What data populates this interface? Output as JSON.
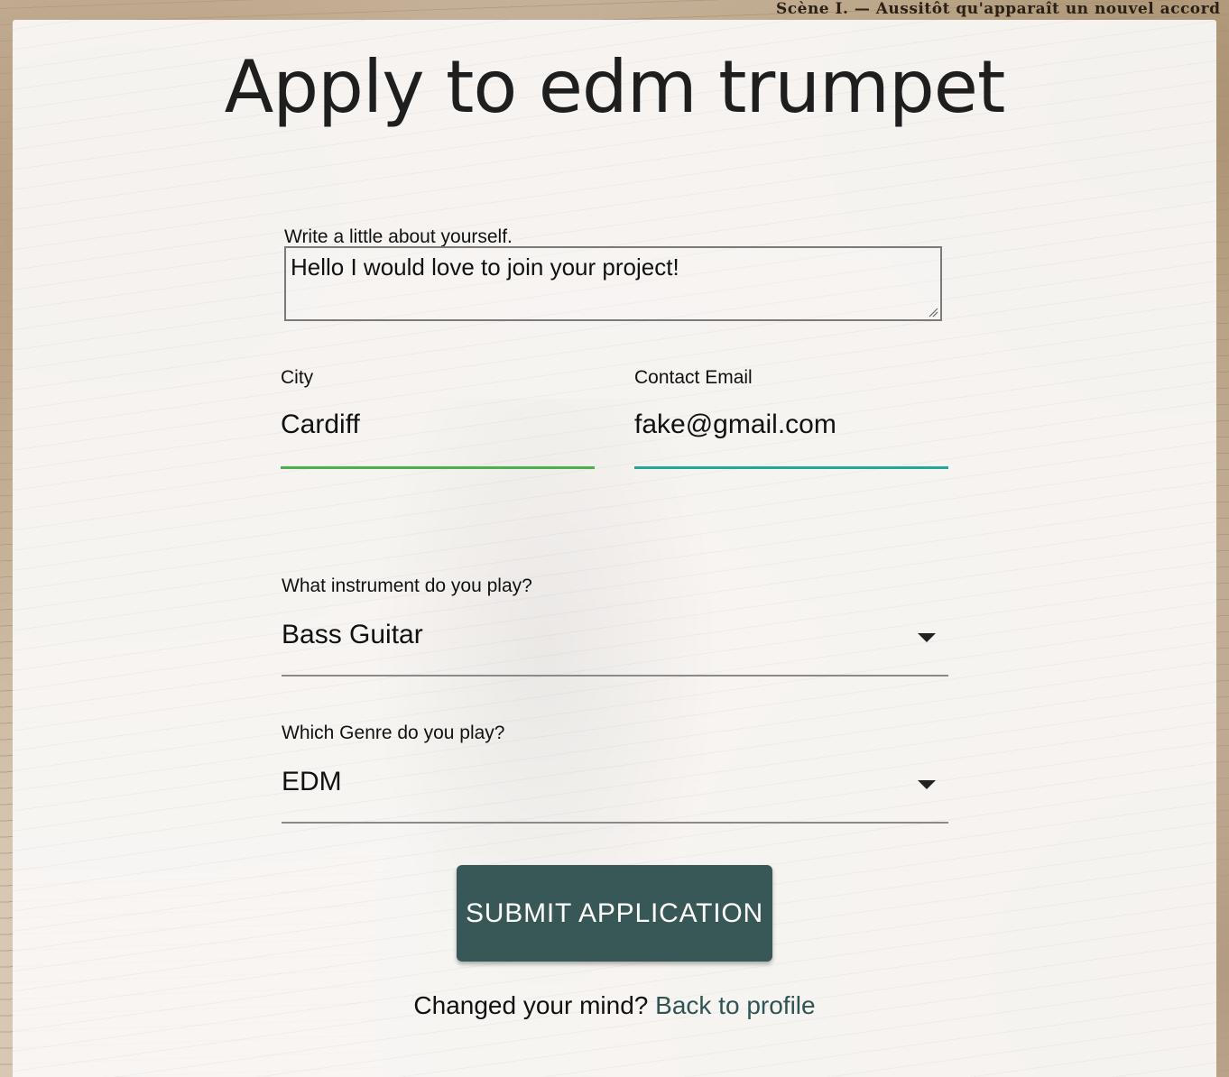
{
  "background": {
    "corner_text": "Scène I. — Aussitôt qu'apparaît un nouvel accord"
  },
  "page": {
    "title": "Apply to edm trumpet"
  },
  "about": {
    "label": "Write a little about yourself.",
    "value": "Hello I would love to join your project!"
  },
  "city": {
    "label": "City",
    "value": "Cardiff",
    "underline_color": "#4caf50"
  },
  "email": {
    "label": "Contact Email",
    "value": "fake@gmail.com",
    "underline_color": "#26a69a"
  },
  "instrument": {
    "label": "What instrument do you play?",
    "selected": "Bass Guitar"
  },
  "genre": {
    "label": "Which Genre do you play?",
    "selected": "EDM"
  },
  "submit": {
    "label": "SUBMIT APPLICATION",
    "color": "#385857"
  },
  "footer": {
    "prompt": "Changed your mind?",
    "link": "Back to profile"
  }
}
